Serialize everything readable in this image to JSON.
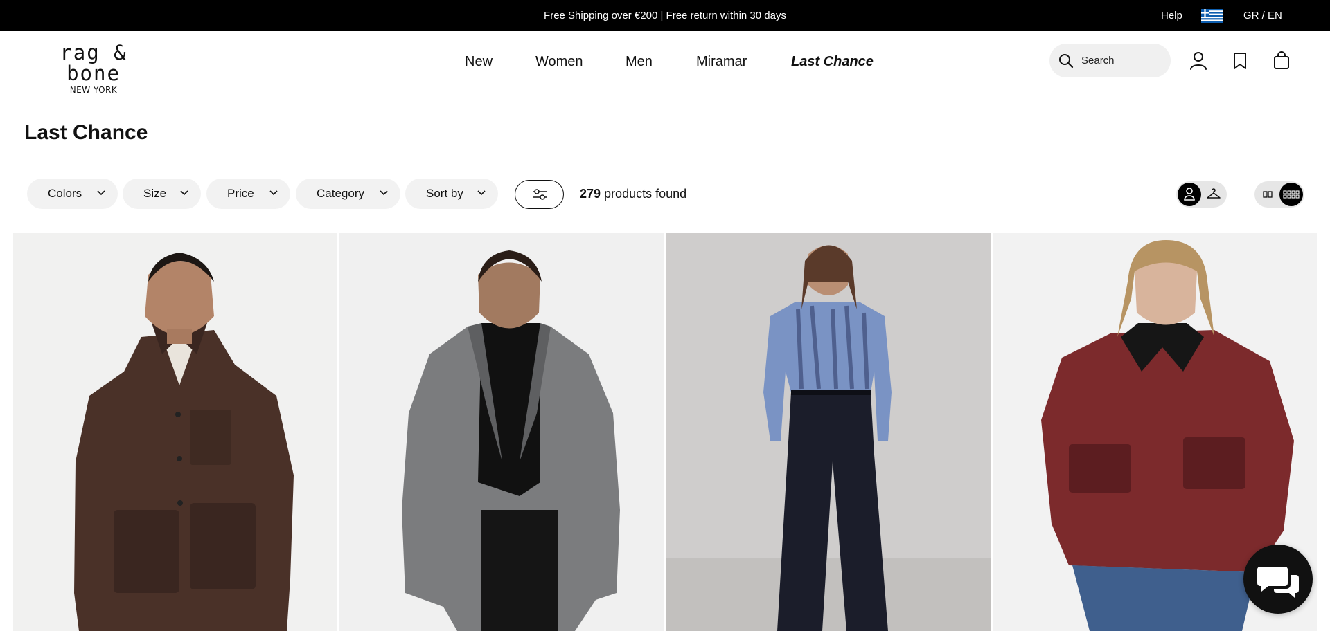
{
  "topbar": {
    "promo": "Free Shipping over €200 | Free return within 30 days",
    "help": "Help",
    "flag_icon": "greece-flag-icon",
    "language": "GR / EN"
  },
  "header": {
    "logo": {
      "brand": "rag & bone",
      "sub": "NEW YORK"
    },
    "nav": [
      {
        "label": "New"
      },
      {
        "label": "Women"
      },
      {
        "label": "Men"
      },
      {
        "label": "Miramar"
      },
      {
        "label": "Last Chance"
      }
    ],
    "search_placeholder": "Search",
    "icons": [
      "search-icon",
      "account-icon",
      "wishlist-bookmark-icon",
      "shopping-bag-icon"
    ]
  },
  "page": {
    "title": "Last Chance"
  },
  "filters": {
    "pills": [
      {
        "label": "Colors"
      },
      {
        "label": "Size"
      },
      {
        "label": "Price"
      },
      {
        "label": "Category"
      },
      {
        "label": "Sort by"
      }
    ],
    "count_number": "279",
    "count_suffix": " products found"
  },
  "view_toggles": {
    "model_view": "model-view-icon",
    "product_view": "hanger-view-icon",
    "two_col": "two-column-grid-icon",
    "four_col": "four-column-grid-icon"
  },
  "products": [
    {
      "icon": "product-image-brown-suede-jacket",
      "colors": {
        "bg": "#f1f1f0",
        "garment": "#4a3128",
        "shade": "#3a2620"
      }
    },
    {
      "icon": "product-image-grey-wool-blazer",
      "colors": {
        "bg": "#f0f0f0",
        "garment": "#7b7c7e",
        "shade": "#5e5f61"
      }
    },
    {
      "icon": "product-image-tie-dye-top-jeans",
      "colors": {
        "bg": "#cfcdcc",
        "garment": "#7a93c4",
        "shade": "#1b1d2a"
      }
    },
    {
      "icon": "product-image-burgundy-leather-jacket",
      "colors": {
        "bg": "#f2f2f2",
        "garment": "#7c2a2c",
        "shade": "#5c1d20"
      }
    }
  ],
  "chat": {
    "icon": "chat-bubbles-icon"
  },
  "colors": {
    "topbar": "#000000",
    "pill_bg": "#f2f2f2",
    "text": "#111111"
  }
}
